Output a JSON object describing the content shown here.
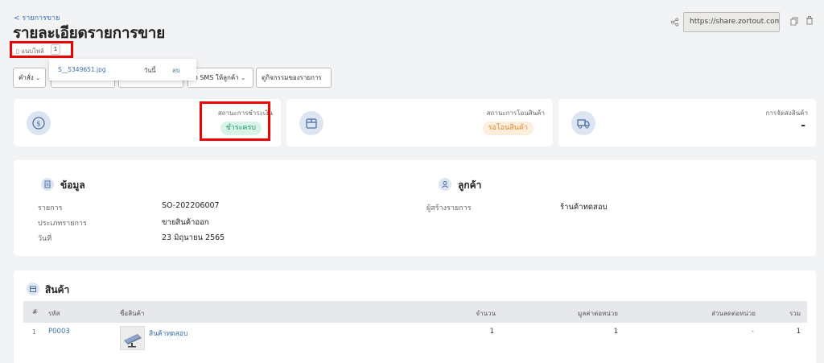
{
  "header": {
    "back_label": "< รายการขาย",
    "title": "รายละเอียดรายการขาย",
    "attach_label": "แนบไฟล์",
    "attach_count": "1",
    "share_url": "https://share.zortout.com/zo"
  },
  "attachment_dropdown": {
    "file_name": "S__5349651.jpg",
    "date": "วันนี้",
    "delete_label": "ลบ"
  },
  "toolbar": {
    "command_label": "คำสั่ง",
    "sms_label": "ส่ง SMS ให้ลูกค้า",
    "history_label": "ดูกิจกรรมของรายการ"
  },
  "status_cards": [
    {
      "label": "สถานะการชำระเงิน",
      "value": "ชำระครบ"
    },
    {
      "label": "สถานะการโอนสินค้า",
      "value": "รอโอนสินค้า"
    },
    {
      "label": "การจัดส่งสินค้า",
      "value": "-"
    }
  ],
  "info": {
    "title": "ข้อมูล",
    "fields": [
      {
        "label": "รายการ",
        "value": "SO-202206007"
      },
      {
        "label": "ประเภทรายการ",
        "value": "ขายสินค้าออก"
      },
      {
        "label": "วันที่",
        "value": "23 มิถุนายน 2565"
      }
    ]
  },
  "customer": {
    "title": "ลูกค้า",
    "fields": [
      {
        "label": "ผู้สร้างรายการ",
        "value": "ร้านค้าทดสอบ"
      }
    ]
  },
  "products": {
    "title": "สินค้า",
    "columns": [
      "#",
      "รหัส",
      "ชื่อสินค้า",
      "จำนวน",
      "มูลค่าต่อหน่วย",
      "ส่วนลดต่อหน่วย",
      "รวม"
    ],
    "rows": [
      {
        "no": "1",
        "code": "P0003",
        "name": "สินค้าทดสอบ",
        "qty": "1",
        "unit_price": "1",
        "discount": "-",
        "total": "1"
      }
    ]
  },
  "colors": {
    "accent": "#3a6fb5",
    "highlight": "#ee0000",
    "paid_badge_text": "#1a9a68",
    "waiting_badge_text": "#e08a2b"
  },
  "icons": {
    "payment": "dollar-circle-icon",
    "transfer": "box-icon",
    "shipping": "truck-icon",
    "info": "clipboard-icon",
    "customer": "user-icon",
    "products": "package-icon",
    "share": "share-icon",
    "copy": "copy-icon",
    "delete": "trash-icon"
  }
}
